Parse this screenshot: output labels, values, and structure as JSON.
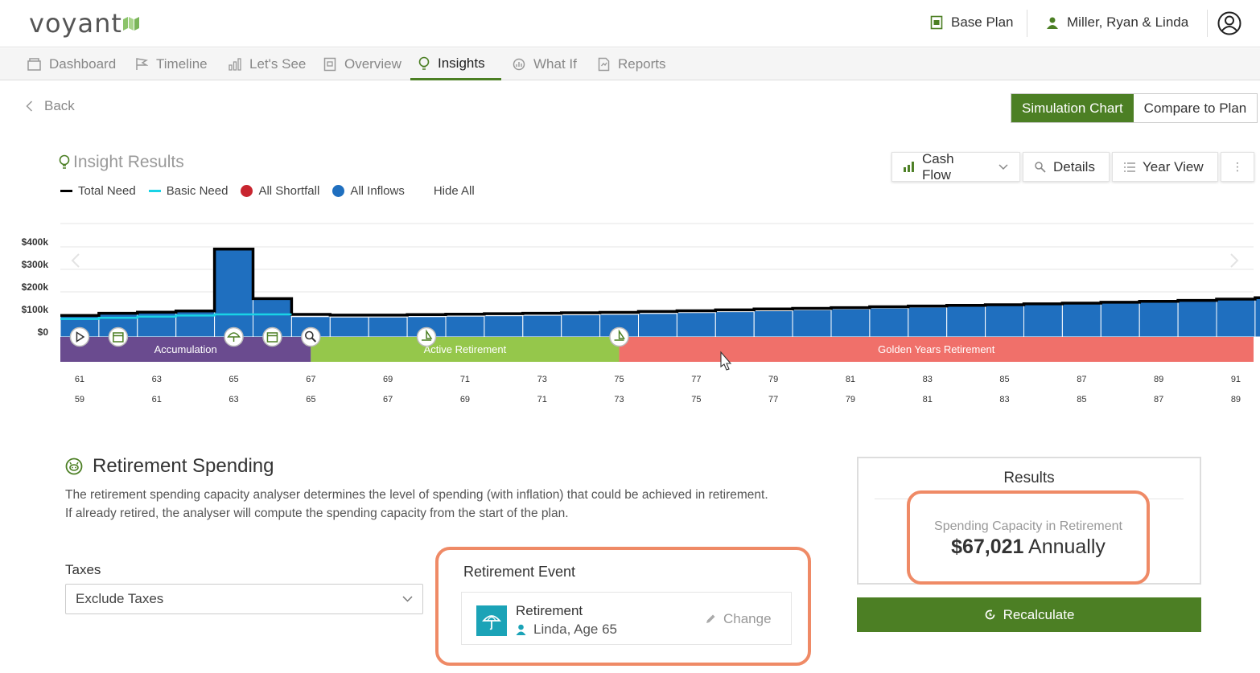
{
  "header": {
    "logo_text": "voyant",
    "plan_label": "Base Plan",
    "client_label": "Miller, Ryan & Linda"
  },
  "tabs": [
    {
      "label": "Dashboard",
      "icon": "dashboard-icon"
    },
    {
      "label": "Timeline",
      "icon": "flag-icon"
    },
    {
      "label": "Let's See",
      "icon": "bar-chart-icon"
    },
    {
      "label": "Overview",
      "icon": "document-icon"
    },
    {
      "label": "Insights",
      "icon": "lightbulb-icon",
      "active": true
    },
    {
      "label": "What If",
      "icon": "chart-circle-icon"
    },
    {
      "label": "Reports",
      "icon": "report-icon"
    }
  ],
  "nav": {
    "back_label": "Back",
    "view_toggle": {
      "simulation": "Simulation Chart",
      "compare": "Compare to Plan"
    }
  },
  "insight": {
    "title": "Insight Results",
    "legend": [
      {
        "label": "Total Need",
        "type": "line",
        "color": "#000000"
      },
      {
        "label": "Basic Need",
        "type": "line",
        "color": "#19d3e6"
      },
      {
        "label": "All Shortfall",
        "type": "dot",
        "color": "#c8252f"
      },
      {
        "label": "All Inflows",
        "type": "dot",
        "color": "#1f6fbf"
      }
    ],
    "hide_all": "Hide All",
    "controls": {
      "cash_flow": "Cash Flow",
      "details": "Details",
      "year_view": "Year View",
      "more": "⋮"
    }
  },
  "chart_data": {
    "type": "bar",
    "y_tick_labels": [
      "$400k",
      "$300k",
      "$200k",
      "$100k",
      "$0"
    ],
    "ylim": [
      0,
      400000
    ],
    "inflows": [
      95000,
      105000,
      110000,
      115000,
      390000,
      170000,
      90000,
      88000,
      88000,
      90000,
      92000,
      94000,
      96000,
      98000,
      100000,
      104000,
      108000,
      112000,
      116000,
      120000,
      124000,
      128000,
      132000,
      136000,
      140000,
      144000,
      148000,
      152000,
      156000,
      160000,
      165000,
      170000
    ],
    "total_need": [
      95000,
      105000,
      110000,
      115000,
      390000,
      170000,
      100000,
      97000,
      97000,
      99000,
      101000,
      103000,
      105000,
      107000,
      109000,
      113000,
      116000,
      120000,
      124000,
      127000,
      130000,
      134000,
      137000,
      140000,
      143000,
      147000,
      150000,
      154000,
      158000,
      162000,
      168000,
      174000
    ],
    "basic_need": [
      80000,
      85000,
      90000,
      95000,
      100000,
      100000
    ],
    "phases": [
      {
        "label": "Accumulation",
        "color": "#6a4b8f"
      },
      {
        "label": "Active Retirement",
        "color": "#95c74b"
      },
      {
        "label": "Golden Years Retirement",
        "color": "#f0706a"
      }
    ],
    "age_row_1": [
      "61",
      "63",
      "65",
      "67",
      "69",
      "71",
      "73",
      "75",
      "77",
      "79",
      "81",
      "83",
      "85",
      "87",
      "89",
      "91"
    ],
    "age_row_2": [
      "59",
      "61",
      "63",
      "65",
      "67",
      "69",
      "71",
      "73",
      "75",
      "77",
      "79",
      "81",
      "83",
      "85",
      "87",
      "89"
    ],
    "events": [
      {
        "icon": "play-icon"
      },
      {
        "icon": "calendar-icon"
      },
      {
        "icon": "umbrella-icon"
      },
      {
        "icon": "calendar-icon"
      },
      {
        "icon": "magnify-icon"
      },
      {
        "icon": "sailboat-icon"
      },
      {
        "icon": "sailboat-icon"
      }
    ]
  },
  "spending": {
    "title": "Retirement Spending",
    "description_1": "The retirement spending capacity analyser determines the level of spending (with inflation) that could be achieved in retirement.",
    "description_2": "If already retired, the analyser will compute the spending capacity from the start of the plan.",
    "taxes_label": "Taxes",
    "taxes_value": "Exclude Taxes",
    "event_title": "Retirement Event",
    "event_name": "Retirement",
    "event_person": "Linda, Age 65",
    "change_label": "Change"
  },
  "results": {
    "title": "Results",
    "capacity_label": "Spending Capacity in Retirement",
    "capacity_amount": "$67,021",
    "capacity_period": "Annually",
    "recalculate_label": "Recalculate"
  }
}
